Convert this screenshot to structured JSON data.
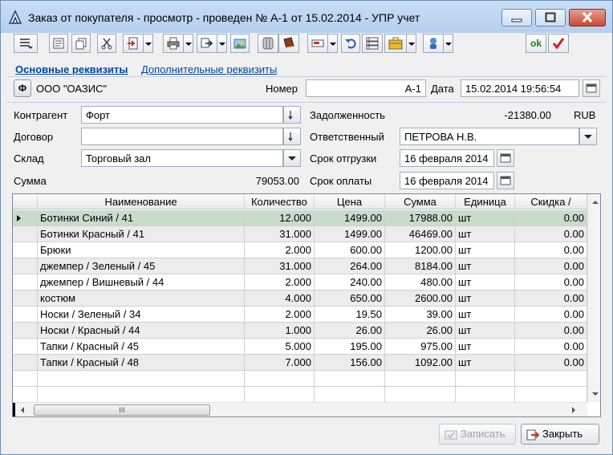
{
  "window": {
    "title": "Заказ от покупателя - просмотр - проведен № А-1 от 15.02.2014 - УПР учет"
  },
  "toolbar": {
    "ok_label": "ok"
  },
  "tabs": {
    "main": "Основные реквизиты",
    "additional": "Дополнительные реквизиты"
  },
  "header": {
    "org_button": "Ф",
    "organization": "ООО \"ОАЗИС\"",
    "number_label": "Номер",
    "number_value": "А-1",
    "date_label": "Дата",
    "date_value": "15.02.2014 19:56:54"
  },
  "form": {
    "contractor_label": "Контрагент",
    "contractor_value": "Форт",
    "contract_label": "Договор",
    "contract_value": "",
    "warehouse_label": "Склад",
    "warehouse_value": "Торговый зал",
    "sum_label": "Сумма",
    "sum_value": "79053.00",
    "debt_label": "Задолженность",
    "debt_value": "-21380.00",
    "debt_currency": "RUB",
    "responsible_label": "Ответственный",
    "responsible_value": "ПЕТРОВА Н.В.",
    "ship_date_label": "Срок отгрузки",
    "ship_date_value": "16 февраля 2014",
    "pay_date_label": "Срок оплаты",
    "pay_date_value": "16 февраля 2014"
  },
  "table": {
    "columns": [
      "Наименование",
      "Количество",
      "Цена",
      "Сумма",
      "Единица",
      "Скидка /"
    ],
    "rows": [
      {
        "name": "Ботинки Синий / 41",
        "qty": "12.000",
        "price": "1499.00",
        "sum": "17988.00",
        "unit": "шт",
        "discount": "0.00"
      },
      {
        "name": "Ботинки Красный / 41",
        "qty": "31.000",
        "price": "1499.00",
        "sum": "46469.00",
        "unit": "шт",
        "discount": "0.00"
      },
      {
        "name": "Брюки",
        "qty": "2.000",
        "price": "600.00",
        "sum": "1200.00",
        "unit": "шт",
        "discount": "0.00"
      },
      {
        "name": "джемпер  / Зеленый / 45",
        "qty": "31.000",
        "price": "264.00",
        "sum": "8184.00",
        "unit": "шт",
        "discount": "0.00"
      },
      {
        "name": "джемпер  / Вишневый / 44",
        "qty": "2.000",
        "price": "240.00",
        "sum": "480.00",
        "unit": "шт",
        "discount": "0.00"
      },
      {
        "name": "костюм",
        "qty": "4.000",
        "price": "650.00",
        "sum": "2600.00",
        "unit": "шт",
        "discount": "0.00"
      },
      {
        "name": "Носки  / Зеленый / 34",
        "qty": "2.000",
        "price": "19.50",
        "sum": "39.00",
        "unit": "шт",
        "discount": "0.00"
      },
      {
        "name": "Носки  / Красный / 44",
        "qty": "1.000",
        "price": "26.00",
        "sum": "26.00",
        "unit": "шт",
        "discount": "0.00"
      },
      {
        "name": "Тапки  / Красный / 45",
        "qty": "5.000",
        "price": "195.00",
        "sum": "975.00",
        "unit": "шт",
        "discount": "0.00"
      },
      {
        "name": "Тапки  / Красный / 48",
        "qty": "7.000",
        "price": "156.00",
        "sum": "1092.00",
        "unit": "шт",
        "discount": "0.00"
      }
    ],
    "scroll_thumb_label": "III"
  },
  "footer": {
    "save_label": "Записать",
    "close_label": "Закрыть"
  },
  "colors": {
    "selected_row": "#c7dccc",
    "alt_row": "#ececec",
    "link": "#0046a8"
  }
}
